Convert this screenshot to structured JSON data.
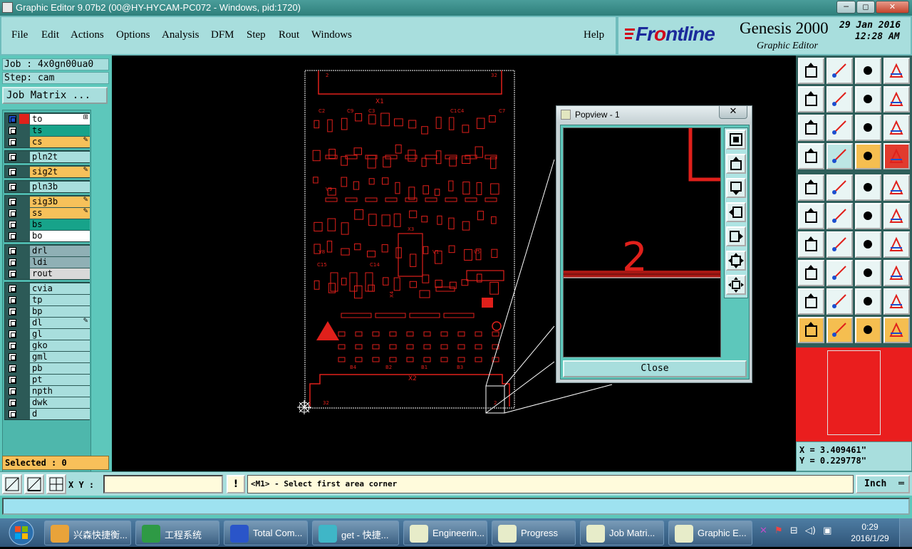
{
  "window": {
    "title": "Graphic Editor 9.07b2 (00@HY-HYCAM-PC072 - Windows, pid:1720)",
    "controls": [
      "─",
      "◻",
      "✕"
    ]
  },
  "menu": {
    "items": [
      "File",
      "Edit",
      "Actions",
      "Options",
      "Analysis",
      "DFM",
      "Step",
      "Rout",
      "Windows"
    ],
    "help": "Help"
  },
  "brand": {
    "logo_prefix": "Fr",
    "logo_o": "o",
    "logo_suffix": "ntline",
    "product": "Genesis 2000",
    "subtitle": "Graphic Editor",
    "date": "29 Jan 2016",
    "time": "12:28 AM"
  },
  "left_panel": {
    "job": "Job  : 4x0gn00ua0",
    "step": "Step: cam",
    "job_matrix": "Job Matrix ...",
    "layer_groups": [
      {
        "layers": [
          {
            "name": "to",
            "color": "#ffffff",
            "active": true,
            "edit": "⊞"
          },
          {
            "name": "ts",
            "color": "#17a38a",
            "edit": ""
          },
          {
            "name": "cs",
            "color": "#f7c15a",
            "edit": "✎"
          }
        ]
      },
      {
        "layers": [
          {
            "name": "pln2t",
            "color": "#a8dedd",
            "edit": ""
          }
        ]
      },
      {
        "layers": [
          {
            "name": "sig2t",
            "color": "#f7c15a",
            "edit": "✎"
          }
        ]
      },
      {
        "layers": [
          {
            "name": "pln3b",
            "color": "#a8dedd",
            "edit": ""
          }
        ]
      },
      {
        "layers": [
          {
            "name": "sig3b",
            "color": "#f7c15a",
            "edit": "✎"
          },
          {
            "name": "ss",
            "color": "#f7c15a",
            "edit": "✎"
          },
          {
            "name": "bs",
            "color": "#17a38a",
            "edit": ""
          },
          {
            "name": "bo",
            "color": "#ffffff",
            "edit": ""
          }
        ]
      },
      {
        "layers": [
          {
            "name": "drl",
            "color": "#8fb0b5",
            "edit": ""
          },
          {
            "name": "ldi",
            "color": "#8fb0b5",
            "edit": ""
          },
          {
            "name": "rout",
            "color": "#d9d9d9",
            "edit": ""
          }
        ]
      },
      {
        "layers": [
          {
            "name": "cvia",
            "color": "#a8dedd",
            "edit": ""
          },
          {
            "name": "tp",
            "color": "#a8dedd",
            "edit": ""
          },
          {
            "name": "bp",
            "color": "#a8dedd",
            "edit": ""
          },
          {
            "name": "dl",
            "color": "#a8dedd",
            "edit": "✎"
          },
          {
            "name": "gl",
            "color": "#a8dedd",
            "edit": ""
          },
          {
            "name": "gko",
            "color": "#a8dedd",
            "edit": ""
          },
          {
            "name": "gml",
            "color": "#a8dedd",
            "edit": ""
          },
          {
            "name": "pb",
            "color": "#a8dedd",
            "edit": ""
          },
          {
            "name": "pt",
            "color": "#a8dedd",
            "edit": ""
          },
          {
            "name": "npth",
            "color": "#a8dedd",
            "edit": ""
          },
          {
            "name": "dwk",
            "color": "#a8dedd",
            "edit": ""
          },
          {
            "name": "d",
            "color": "#a8dedd",
            "edit": ""
          }
        ]
      }
    ],
    "selected": "Selected : 0"
  },
  "board": {
    "labels": {
      "x1": "X1",
      "x2": "X2",
      "c1": "C1",
      "c2": "C2",
      "c3": "C3",
      "c4": "C4",
      "c7": "C7",
      "c9": "C9",
      "c14": "C14",
      "c15": "C15",
      "v8": "V8",
      "v9": "V9",
      "v5": "V5",
      "v1": "V1",
      "x3": "X3",
      "x4": "X4",
      "b1": "B1",
      "b2": "B2",
      "b3": "B3",
      "b4": "B4",
      "pin2": "2",
      "pin32": "32",
      "pin_b2": "2"
    }
  },
  "popview": {
    "title": "Popview - 1",
    "close_x": "✕",
    "zoom_text": "2",
    "close_button": "Close"
  },
  "coords": {
    "x": "X = 3.409461\"",
    "y": "Y = 0.229778\""
  },
  "status": {
    "xy_label": "X Y :",
    "xy_value": "",
    "excl": "!",
    "message": "<M1> - Select first area corner",
    "unit": "Inch",
    "unit_dash": "═"
  },
  "taskbar": {
    "tasks": [
      {
        "label": "兴森快捷衡...",
        "icon": "flower-icon"
      },
      {
        "label": "工程系统",
        "icon": "f-icon"
      },
      {
        "label": "Total Com...",
        "icon": "floppy-icon"
      },
      {
        "label": "get - 快捷...",
        "icon": "eye-icon"
      },
      {
        "label": "Engineerin...",
        "icon": "genesis-icon"
      },
      {
        "label": "Progress",
        "icon": "genesis-icon"
      },
      {
        "label": "Job Matri...",
        "icon": "genesis-icon"
      },
      {
        "label": "Graphic E...",
        "icon": "genesis-icon"
      }
    ],
    "clock_time": "0:29",
    "clock_date": "2016/1/29"
  }
}
